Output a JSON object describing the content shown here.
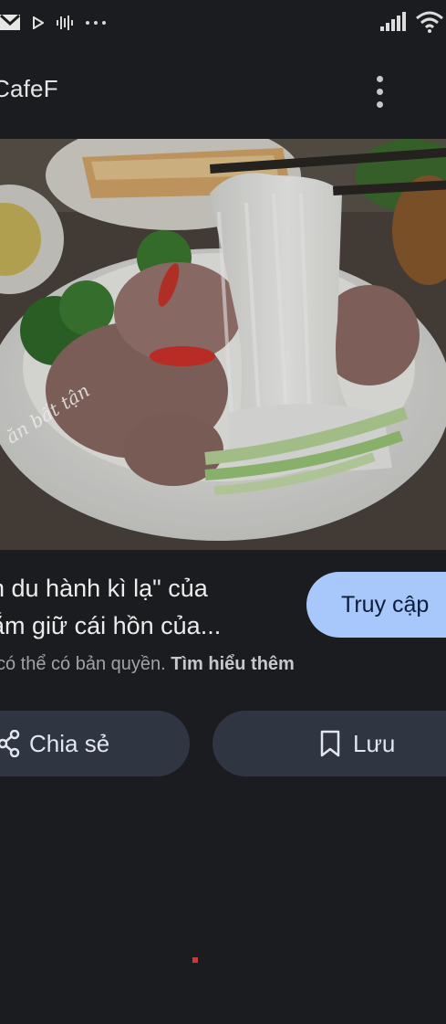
{
  "status_bar": {
    "left_icons": [
      "gmail-icon",
      "play-icon",
      "audio-wave-icon",
      "more-dots-icon"
    ],
    "right_icons": [
      "signal-icon",
      "wifi-icon"
    ]
  },
  "app_bar": {
    "source_name": "CafeF",
    "more_icon": "more-vert-icon"
  },
  "image": {
    "description_icon": "food-photo",
    "watermark": "ăn bất tận"
  },
  "caption": {
    "line1": "n du hành kì lạ\" của",
    "line2": "ắm giữ cái hồn của..."
  },
  "visit_button": {
    "label": "Truy cập"
  },
  "copyright": {
    "text": "có thể có bản quyền.",
    "link": "Tìm hiểu thêm"
  },
  "actions": {
    "share_label": "Chia sẻ",
    "save_label": "Lưu"
  },
  "colors": {
    "background": "#1b1c1f",
    "accent": "#a8c7fa",
    "button_bg": "#303542"
  }
}
